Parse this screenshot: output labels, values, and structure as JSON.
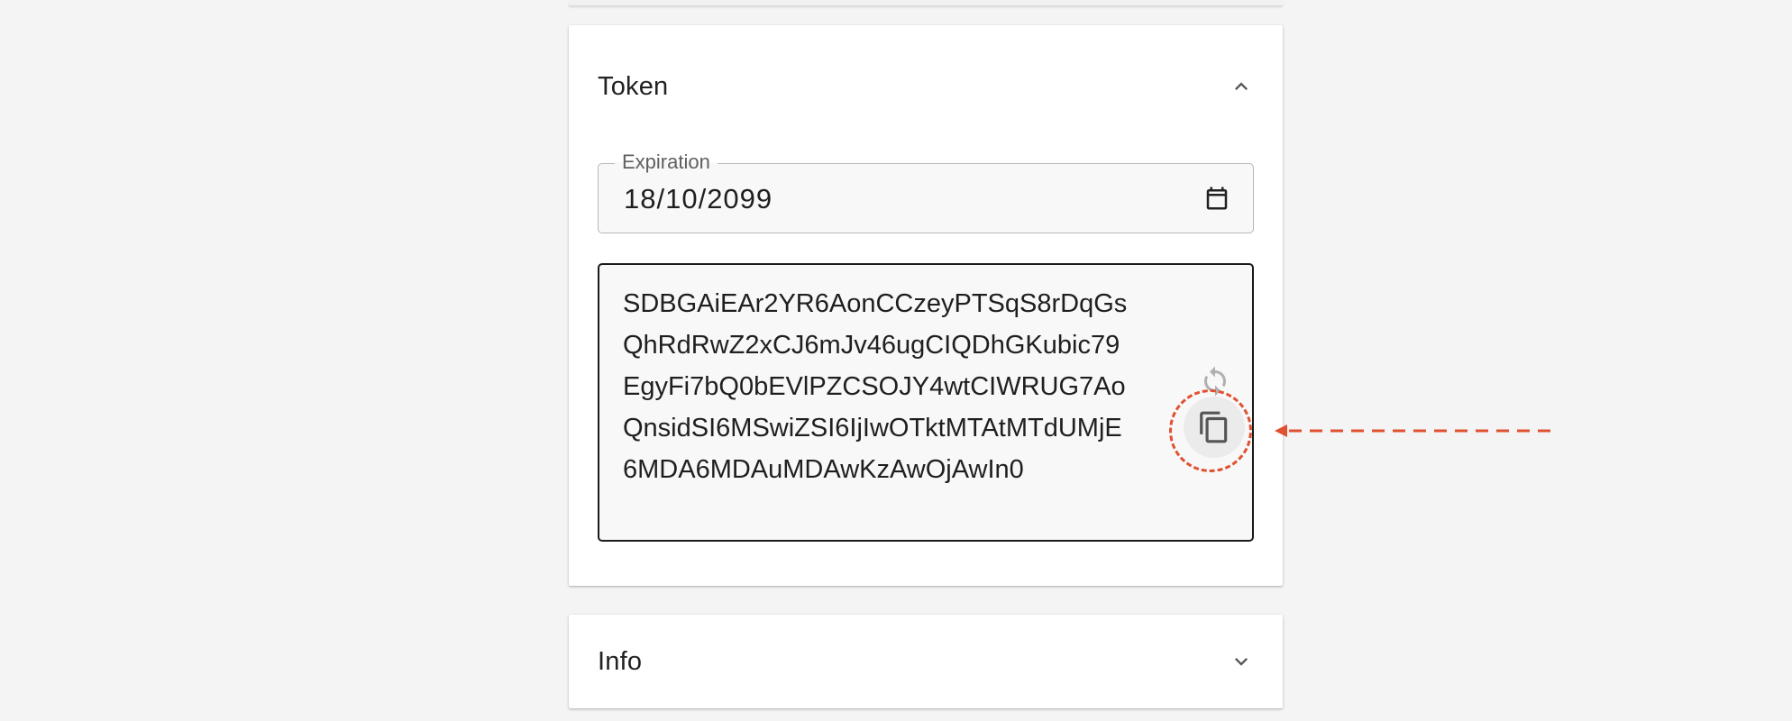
{
  "token_panel": {
    "title": "Token",
    "expanded": true,
    "chevron_icon": "chevron-up-icon",
    "expiration": {
      "label": "Expiration",
      "value": "18/10/2099",
      "calendar_icon": "calendar-icon"
    },
    "token_lines": [
      "SDBGAiEAr2YR6AonCCzeyPTSqS8rDqGs",
      "QhRdRwZ2xCJ6mJv46ugCIQDhGKubic79",
      "EgyFi7bQ0bEVlPZCSOJY4wtCIWRUG7Ao",
      "QnsidSI6MSwiZSI6IjIwOTktMTAtMTdUMjE",
      "6MDA6MDAuMDAwKzAwOjAwIn0"
    ],
    "refresh_icon": "refresh-icon",
    "copy_icon": "copy-icon"
  },
  "info_panel": {
    "title": "Info",
    "expanded": false,
    "chevron_icon": "chevron-down-icon"
  },
  "annotation": {
    "color": "#e0512f",
    "target": "copy-button"
  },
  "colors": {
    "background": "#f4f4f4",
    "panel": "#ffffff",
    "field_background": "#f8f8f8",
    "icon": "#555555",
    "icon_disabled": "#b0b0b0"
  }
}
